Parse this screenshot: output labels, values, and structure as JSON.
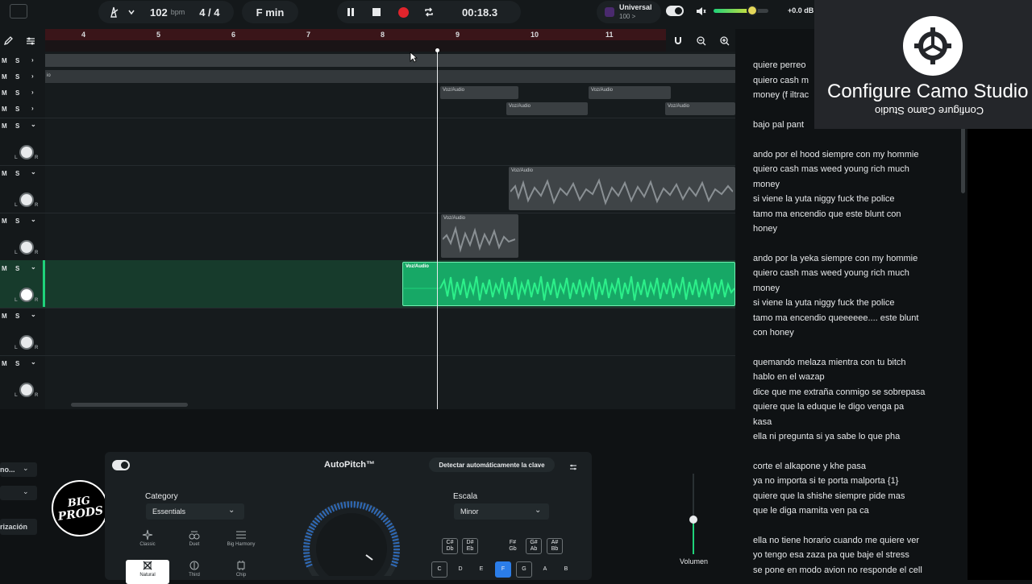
{
  "topbar": {
    "bpm_value": "102",
    "bpm_unit": "bpm",
    "time_signature": "4 / 4",
    "key": "F min",
    "timer": "00:18.3",
    "universal_label": "Universal",
    "universal_value": "100 >",
    "volume_db": "+0.0 dB"
  },
  "ruler": {
    "ticks": [
      "4",
      "5",
      "6",
      "7",
      "8",
      "9",
      "10",
      "11"
    ]
  },
  "tracks": {
    "mute": "M",
    "solo": "S",
    "knob_left": "L",
    "knob_right": "R",
    "clip_label": "Voz/Audio",
    "clip2_partial": "io"
  },
  "lyrics": [
    "quiere perreo",
    "quiero cash m",
    "money (f iltrac",
    "bajo pal pant",
    "ando por el hood siempre con my hommie",
    "quiero cash mas weed  young rich  much",
    "money",
    "si viene la yuta niggy fuck the police",
    " tamo ma encendio que este blunt con",
    "honey",
    " ando por la  yeka siempre con my hommie",
    "quiero cash mas weed  young rich  much",
    "money",
    "si viene la yuta niggy fuck the police",
    " tamo ma encendio queeeeee.... este blunt",
    "con honey",
    "quemando melaza mientra con tu bitch",
    "hablo en el wazap",
    "dice que me extraña conmigo se sobrepasa",
    " quiere que la eduque le digo venga pa",
    "kasa",
    "ella ni pregunta si ya sabe lo que pha",
    " corte el alkapone y khe pasa",
    "ya no importa si te porta malporta {1}",
    "quiere que la shishe siempre pide mas",
    "que  le diga mamita ven  pa ca",
    "ella no tiene horario cuando me quiere ver",
    "yo tengo esa zaza pa que baje el stress",
    " se pone en  modo avion no responde el cell"
  ],
  "camo": {
    "title": "Configure Camo Studio",
    "mirrored": "Configure Camo Studio"
  },
  "left_panel": {
    "dropdown1": "no...",
    "button": "rización"
  },
  "logo": {
    "line1": "BIG",
    "line2": "PRODS"
  },
  "autopitch": {
    "title": "AutoPitch™",
    "detect_button": "Detectar automáticamente la clave",
    "category_label": "Category",
    "category_value": "Essentials",
    "categories": [
      "Classic",
      "Duet",
      "Big Harmony",
      "Natural",
      "Third",
      "Chip"
    ],
    "scale_label": "Escala",
    "scale_value": "Minor",
    "sharp_keys": [
      [
        "C#",
        "Db"
      ],
      [
        "D#",
        "Eb"
      ],
      [
        "F#",
        "Gb"
      ],
      [
        "G#",
        "Ab"
      ],
      [
        "A#",
        "Bb"
      ]
    ],
    "natural_keys": [
      "C",
      "D",
      "E",
      "F",
      "G",
      "A",
      "B"
    ],
    "volume_label": "Volumen"
  },
  "colors": {
    "accent_green": "#1fd27a",
    "record_red": "#e0242c",
    "ruler_red": "#3a1519"
  }
}
